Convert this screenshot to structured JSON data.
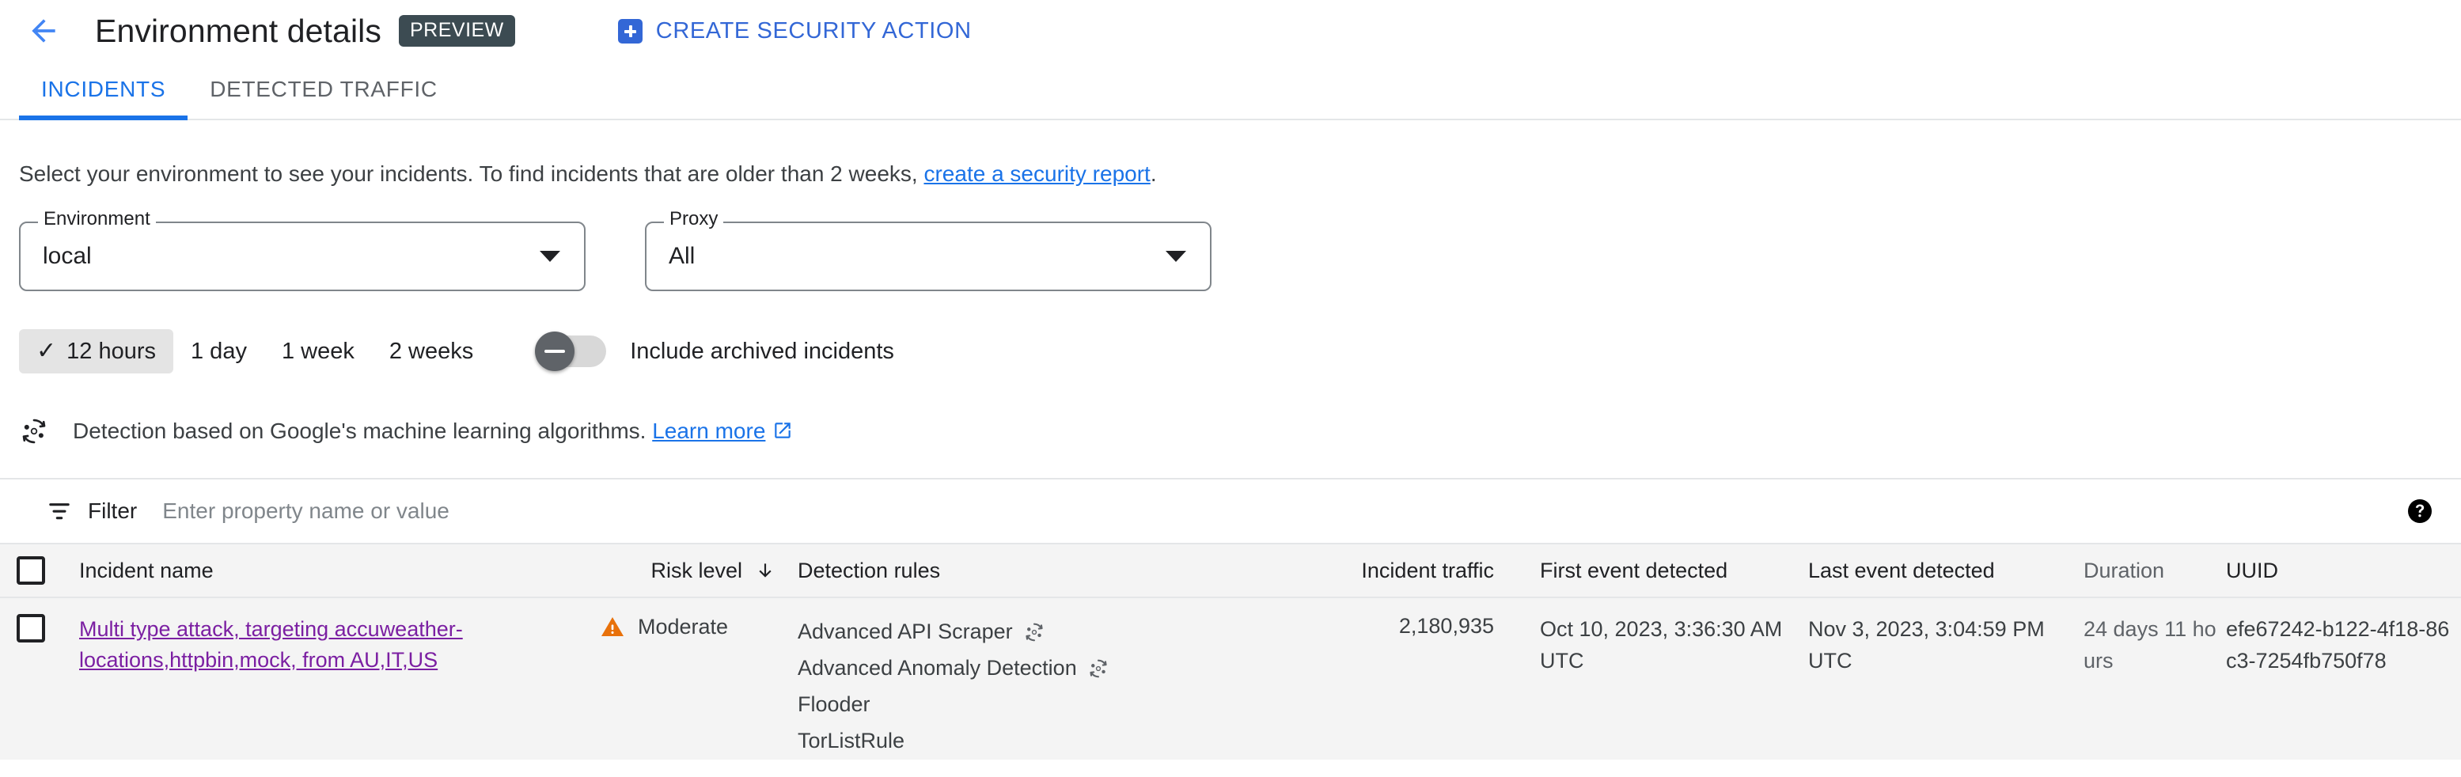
{
  "header": {
    "back_icon": "arrow-left-icon",
    "title": "Environment details",
    "badge": "PREVIEW",
    "create_action": {
      "icon": "plus-square-icon",
      "label": "CREATE SECURITY ACTION"
    }
  },
  "tabs": [
    {
      "label": "INCIDENTS",
      "active": true
    },
    {
      "label": "DETECTED TRAFFIC",
      "active": false
    }
  ],
  "description": {
    "text_before": "Select your environment to see your incidents. To find incidents that are older than 2 weeks,",
    "link": "create a security report",
    "text_after": "."
  },
  "filters": {
    "environment": {
      "legend": "Environment",
      "value": "local"
    },
    "proxy": {
      "legend": "Proxy",
      "value": "All"
    },
    "time_ranges": [
      {
        "label": "12 hours",
        "selected": true
      },
      {
        "label": "1 day",
        "selected": false
      },
      {
        "label": "1 week",
        "selected": false
      },
      {
        "label": "2 weeks",
        "selected": false
      }
    ],
    "archived_toggle": {
      "label": "Include archived incidents",
      "on": false
    }
  },
  "ml_note": {
    "icon": "ml-detection-icon",
    "text": "Detection based on Google's machine learning algorithms.",
    "link": "Learn more",
    "link_icon": "open-in-new-icon"
  },
  "table_filter": {
    "icon": "filter-icon",
    "label": "Filter",
    "placeholder": "Enter property name or value",
    "value": "",
    "help_icon": "help-icon"
  },
  "table": {
    "columns": {
      "incident_name": "Incident name",
      "risk_level": "Risk level",
      "detection_rules": "Detection rules",
      "incident_traffic": "Incident traffic",
      "first_event": "First event detected",
      "last_event": "Last event detected",
      "duration": "Duration",
      "uuid": "UUID"
    },
    "sort": {
      "column": "risk_level",
      "direction": "descending",
      "icon": "arrow-down-icon"
    },
    "rows": [
      {
        "incident_name": "Multi type attack, targeting accuweather-locations,httpbin,mock, from AU,IT,US",
        "risk_level": "Moderate",
        "risk_icon": "warning-triangle-icon",
        "risk_color": "#e8710a",
        "detection_rules": [
          {
            "name": "Advanced API Scraper",
            "ml": true
          },
          {
            "name": "Advanced Anomaly Detection",
            "ml": true
          },
          {
            "name": "Flooder",
            "ml": false
          },
          {
            "name": "TorListRule",
            "ml": false
          }
        ],
        "incident_traffic": "2,180,935",
        "first_event": "Oct 10, 2023, 3:36:30 AM UTC",
        "last_event": "Nov 3, 2023, 3:04:59 PM UTC",
        "duration": "24 days 11 hours",
        "uuid": "efe67242-b122-4f18-86c3-7254fb750f78"
      }
    ]
  },
  "colors": {
    "accent_blue": "#1a73e8",
    "link_purple": "#7b1fa2",
    "warn_orange": "#e8710a",
    "badge_slate": "#3c4b52"
  }
}
